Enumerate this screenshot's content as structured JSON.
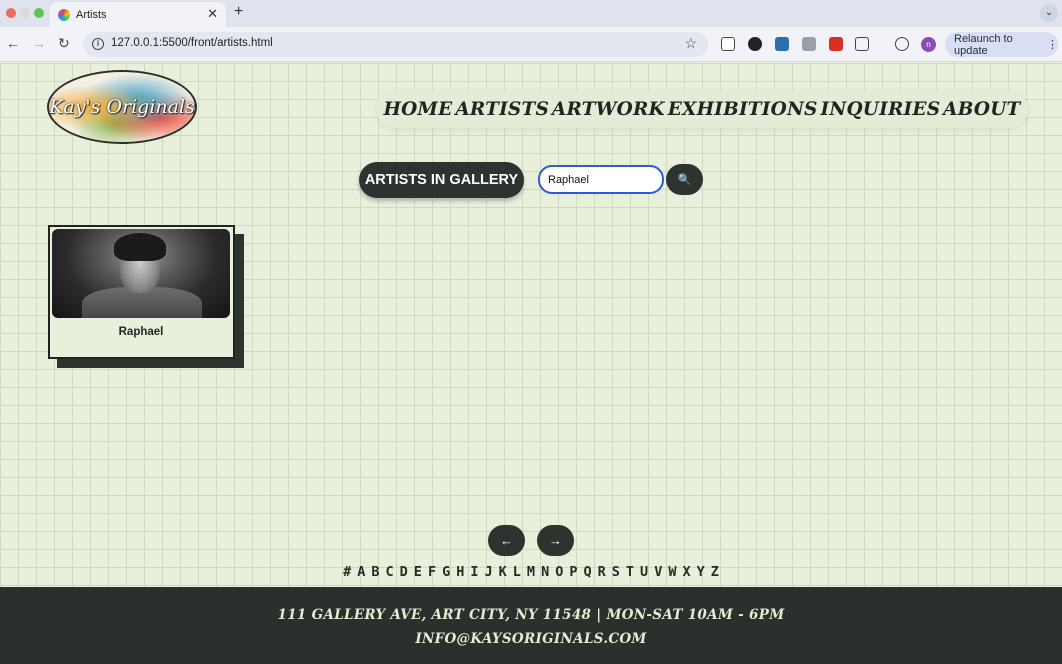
{
  "browser": {
    "tab_title": "Artists",
    "tab_close": "✕",
    "new_tab": "+",
    "url": "127.0.0.1:5500/front/artists.html",
    "relaunch_label": "Relaunch to update",
    "profile_initial": "n"
  },
  "site": {
    "logo_text": "Kay's Originals",
    "nav": [
      "HOME",
      "ARTISTS",
      "ARTWORK",
      "EXHIBITIONS",
      "INQUIRIES",
      "ABOUT"
    ]
  },
  "gallery": {
    "section_label": "ARTISTS IN GALLERY",
    "search_value": "Raphael",
    "search_icon": "🔍"
  },
  "artists": [
    {
      "name": "Raphael"
    }
  ],
  "pagination": {
    "prev": "←",
    "next": "→"
  },
  "alphabet": [
    "#",
    "A",
    "B",
    "C",
    "D",
    "E",
    "F",
    "G",
    "H",
    "I",
    "J",
    "K",
    "L",
    "M",
    "N",
    "O",
    "P",
    "Q",
    "R",
    "S",
    "T",
    "U",
    "V",
    "W",
    "X",
    "Y",
    "Z"
  ],
  "footer": {
    "address_line": "111 GALLERY AVE, ART CITY, NY 11548 | MON-SAT 10AM - 6PM",
    "email": "INFO@KAYSORIGINALS.COM"
  },
  "colors": {
    "page_bg": "#e8f0dc",
    "dark": "#2d332e",
    "footer_bg": "#2a302b"
  }
}
